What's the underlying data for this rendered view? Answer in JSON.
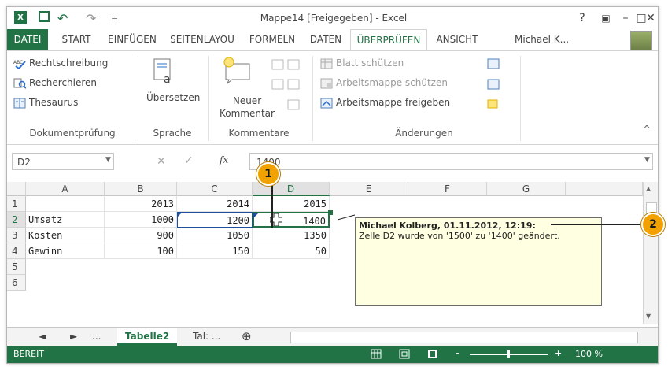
{
  "window": {
    "title": "Mappe14  [Freigegeben] - Excel",
    "help": "?",
    "ribbon_display": "▣",
    "minimize": "–",
    "maximize": "□",
    "close": "✕"
  },
  "quick_access": {
    "app_icon": "excel-logo-icon",
    "app_icon_text": "X",
    "save_icon": "save-icon",
    "undo": "↶",
    "redo": "↷",
    "more": "≡"
  },
  "tabs": [
    "DATEI",
    "START",
    "EINFÜGEN",
    "SEITENLAYOU",
    "FORMELN",
    "DATEN",
    "ÜBERPRÜFEN",
    "ANSICHT"
  ],
  "active_tab": "ÜBERPRÜFEN",
  "user": "Michael K...",
  "ribbon": {
    "proofing": {
      "spelling": "Rechtschreibung",
      "research": "Recherchieren",
      "thesaurus": "Thesaurus",
      "group": "Dokumentprüfung"
    },
    "language": {
      "translate": "Übersetzen",
      "group": "Sprache"
    },
    "comments": {
      "new_comment_1": "Neuer",
      "new_comment_2": "Kommentar",
      "group": "Kommentare"
    },
    "changes": {
      "protect_sheet": "Blatt schützen",
      "protect_workbook": "Arbeitsmappe schützen",
      "share_workbook": "Arbeitsmappe freigeben",
      "group": "Änderungen"
    },
    "collapse": "^"
  },
  "formula_bar": {
    "name_box": "D2",
    "fx": "fx",
    "content": "1400",
    "cancel": "✕",
    "enter": "✓"
  },
  "sheet": {
    "columns": [
      "A",
      "B",
      "C",
      "D",
      "E",
      "F",
      "G"
    ],
    "rows": [
      "1",
      "2",
      "3",
      "4",
      "5",
      "6"
    ],
    "cells": {
      "b1": "2013",
      "c1": "2014",
      "d1": "2015",
      "a2": "Umsatz",
      "b2": "1000",
      "c2": "1200",
      "d2": "1400",
      "a3": "Kosten",
      "b3": "900",
      "c3": "1050",
      "d3": "1350",
      "a4": "Gewinn",
      "b4": "100",
      "c4": "150",
      "d4": "50"
    }
  },
  "comment": {
    "author": "Michael Kolberg, 01.11.2012, 12:19:",
    "text": "Zelle D2 wurde von '1500' zu '1400' geändert."
  },
  "callouts": [
    "1",
    "2"
  ],
  "sheet_tabs": {
    "prev": "◄",
    "next": "►",
    "dots": "...",
    "active": "Tabelle2",
    "other": "Tal:  ...",
    "add": "⊕"
  },
  "status": {
    "ready": "BEREIT",
    "zoom": "100 %"
  },
  "colors": {
    "accent": "#217346",
    "callout": "#f1a200",
    "comment_bg": "#ffffe1"
  }
}
